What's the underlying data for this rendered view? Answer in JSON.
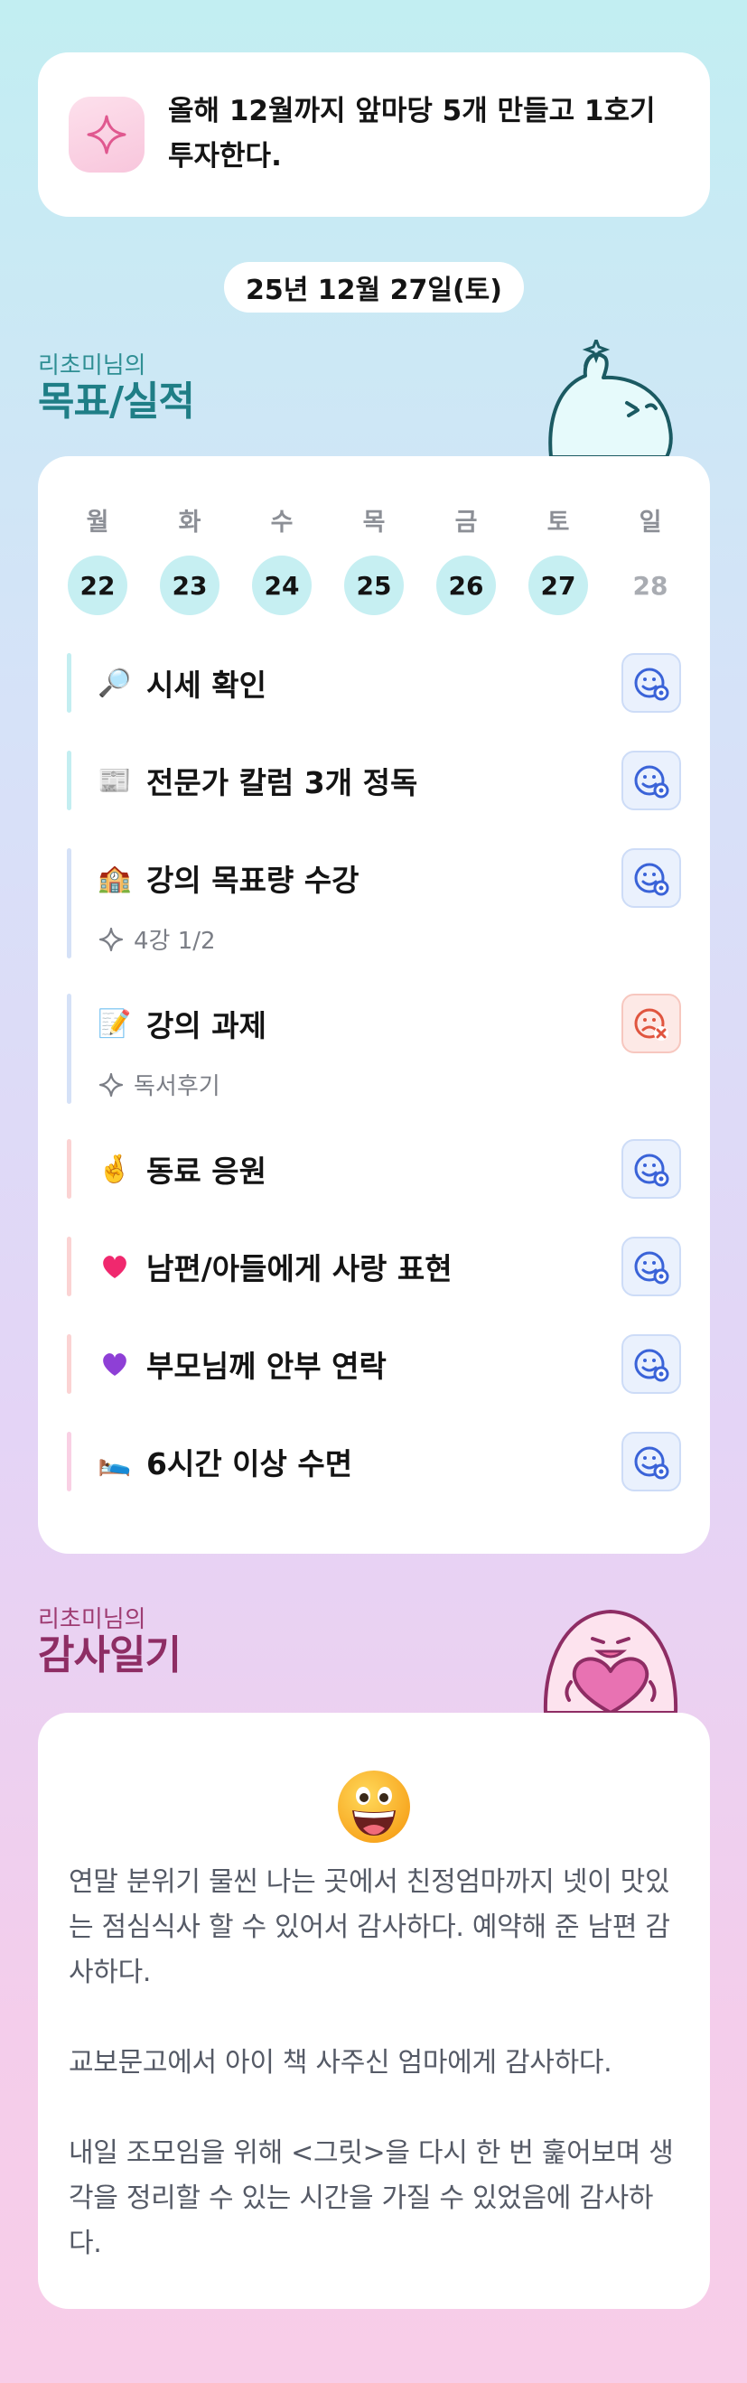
{
  "goal": {
    "text": "올해 12월까지 앞마당 5개 만들고 1호기 투자한다.",
    "icon": "sparkle-icon"
  },
  "date_label": "25년 12월 27일(토)",
  "goals_section": {
    "owner": "리초미님의",
    "title": "목표/실적"
  },
  "week": [
    {
      "name": "월",
      "num": "22",
      "done": true
    },
    {
      "name": "화",
      "num": "23",
      "done": true
    },
    {
      "name": "수",
      "num": "24",
      "done": true
    },
    {
      "name": "목",
      "num": "25",
      "done": true
    },
    {
      "name": "금",
      "num": "26",
      "done": true
    },
    {
      "name": "토",
      "num": "27",
      "done": true
    },
    {
      "name": "일",
      "num": "28",
      "done": false
    }
  ],
  "tasks": [
    {
      "emoji": "🔎",
      "icon": "magnifier-icon",
      "label": "시세 확인",
      "status": "success",
      "bar_color": "#c3eef1"
    },
    {
      "emoji": "📰",
      "icon": "newspaper-icon",
      "label": "전문가 칼럼 3개 정독",
      "status": "success",
      "bar_color": "#c3eef1"
    },
    {
      "emoji": "🏫",
      "icon": "school-icon",
      "label": "강의 목표량 수강",
      "sub": "4강 1/2",
      "status": "success",
      "bar_color": "#d5e1f7"
    },
    {
      "emoji": "📝",
      "icon": "memo-icon",
      "label": "강의 과제",
      "sub": "독서후기",
      "status": "fail",
      "bar_color": "#d5e1f7"
    },
    {
      "emoji": "🤞",
      "icon": "fingers-crossed-icon",
      "label": "동료 응원",
      "status": "success",
      "bar_color": "#fbd3d3"
    },
    {
      "emoji": "❤️",
      "icon": "heart-icon",
      "label": "남편/아들에게 사랑 표현",
      "status": "success",
      "bar_color": "#fbd3d3"
    },
    {
      "emoji": "💜",
      "icon": "purple-heart-icon",
      "label": "부모님께 안부 연락",
      "status": "success",
      "bar_color": "#fbd3d3"
    },
    {
      "emoji": "🛌",
      "icon": "bed-icon",
      "label": "6시간 이상 수면",
      "status": "success",
      "bar_color": "#f9d0e4"
    }
  ],
  "thanks_section": {
    "owner": "리초미님의",
    "title": "감사일기"
  },
  "diary": {
    "emoji_icon": "grinning-face-icon",
    "text": "연말 분위기 물씬 나는 곳에서 친정엄마까지 넷이 맛있는 점심식사 할 수 있어서 감사하다. 예약해 준 남편 감사하다.\n\n교보문고에서 아이 책 사주신 엄마에게 감사하다.\n\n내일 조모임을 위해 <그릿>을 다시 한 번 훑어보며 생각을 정리할 수 있는 시간을 가질 수 있었음에 감사하다."
  },
  "colors": {
    "accent_teal": "#1f7e86",
    "accent_plum": "#8e2d64",
    "success_blue": "#3a63d8",
    "fail_red": "#e0553f",
    "day_done_bg": "#c6eff2"
  }
}
